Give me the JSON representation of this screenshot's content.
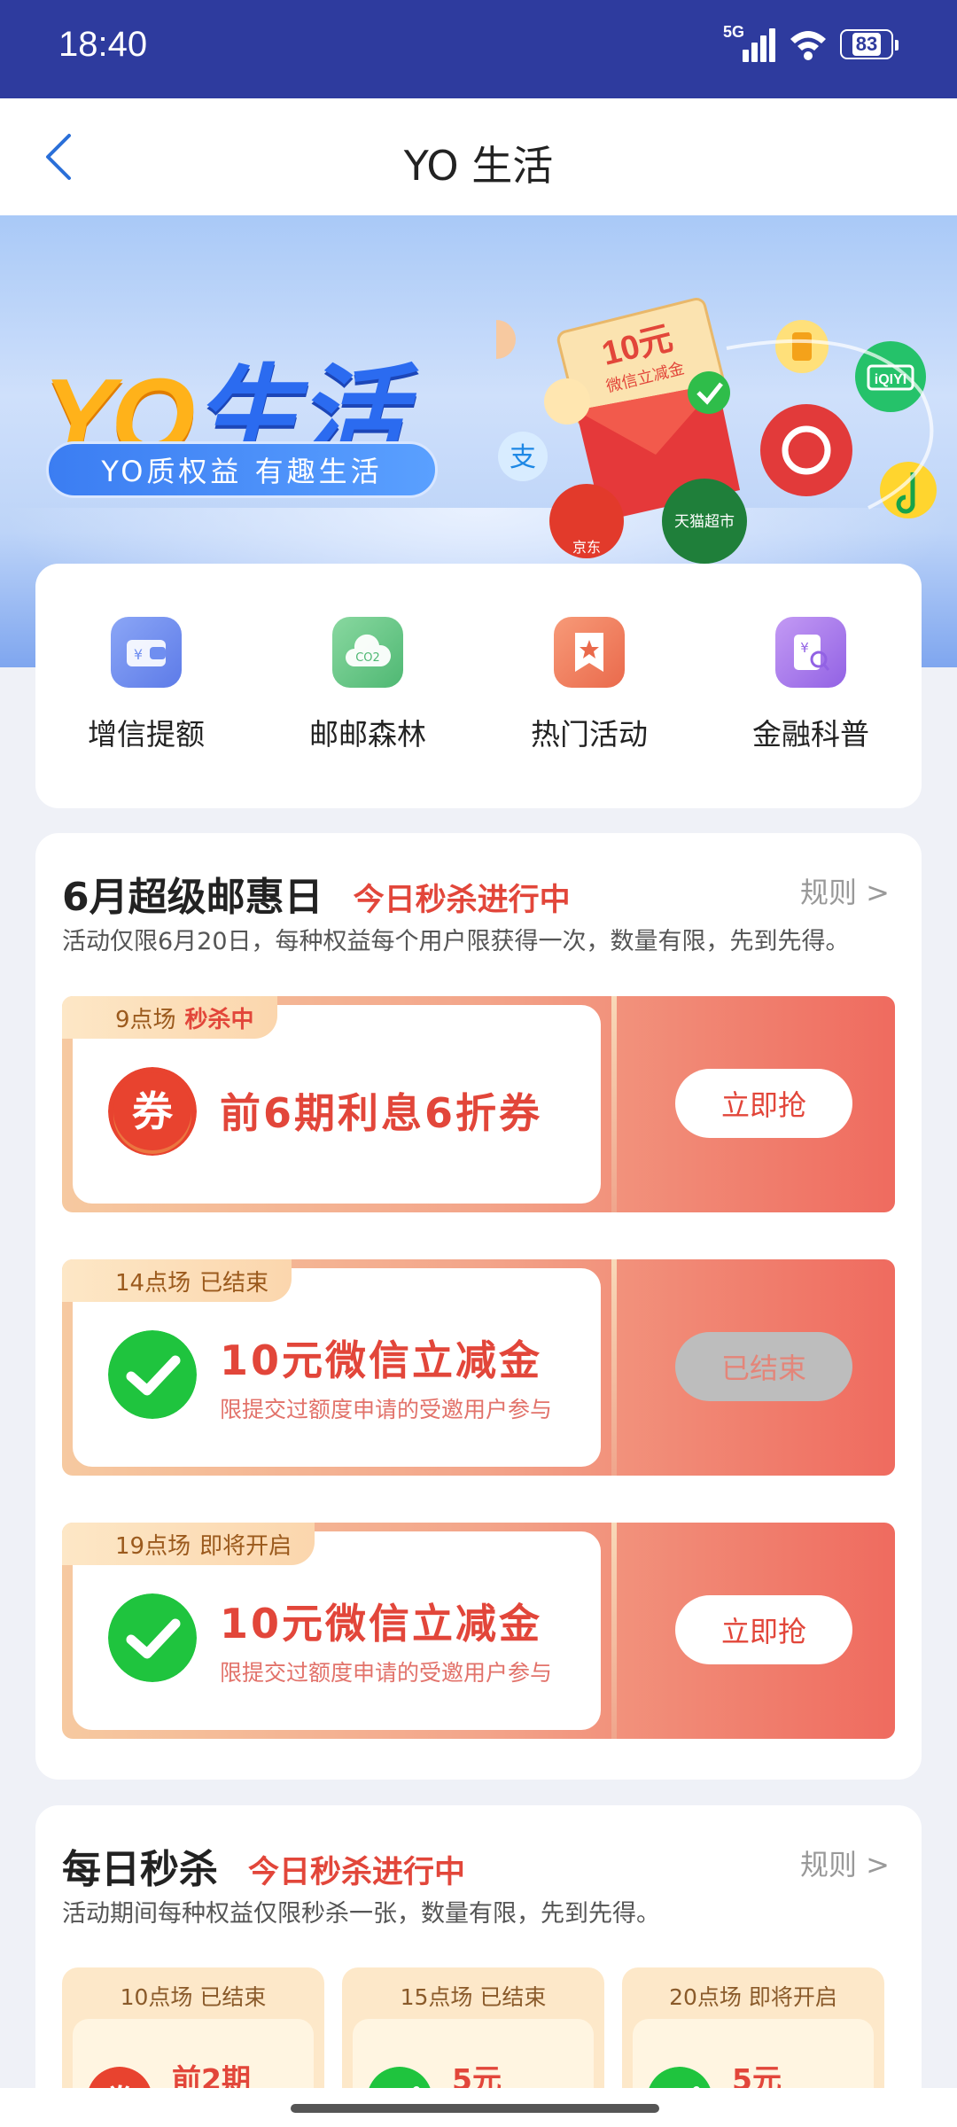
{
  "status": {
    "time": "18:40",
    "network": "5G",
    "battery": "83"
  },
  "nav": {
    "title": "YO 生活"
  },
  "banner": {
    "logo_yo": "YO",
    "logo_sh": "生活",
    "slogan": "YO质权益 有趣生活",
    "coupon_amount": "10元",
    "coupon_text": "微信立减金",
    "jd_label": "京东",
    "tmall_label": "天猫超市",
    "iqiyi_label": "iQIYI",
    "alipay_label": "支"
  },
  "quick_menu": [
    {
      "label": "增信提额",
      "icon": "wallet-icon",
      "color": "#6f8ef0"
    },
    {
      "label": "邮邮森林",
      "icon": "cloud-co2-icon",
      "color": "#5fc27e"
    },
    {
      "label": "热门活动",
      "icon": "bookmark-star-icon",
      "color": "#f07a56"
    },
    {
      "label": "金融科普",
      "icon": "document-search-icon",
      "color": "#a56ee9"
    }
  ],
  "super_day": {
    "title": "6月超级邮惠日",
    "subtitle": "今日秒杀进行中",
    "rule": "规则 >",
    "desc": "活动仅限6月20日，每种权益每个用户限获得一次，数量有限，先到先得。",
    "deals": [
      {
        "session": "9点场",
        "state": "秒杀中",
        "name": "前6期利息6折券",
        "note": "",
        "button": "立即抢",
        "icon": "coupon-icon",
        "ended": false
      },
      {
        "session": "14点场",
        "state": "已结束",
        "name": "10元微信立减金",
        "note": "限提交过额度申请的受邀用户参与",
        "button": "已结束",
        "icon": "wechat-icon",
        "ended": true
      },
      {
        "session": "19点场",
        "state": "即将开启",
        "name": "10元微信立减金",
        "note": "限提交过额度申请的受邀用户参与",
        "button": "立即抢",
        "icon": "wechat-icon",
        "ended": false
      }
    ]
  },
  "daily": {
    "title": "每日秒杀",
    "subtitle": "今日秒杀进行中",
    "rule": "规则 >",
    "desc": "活动期间每种权益仅限秒杀一张，数量有限，先到先得。",
    "items": [
      {
        "tag": "10点场 已结束",
        "name": "前2期",
        "icon": "coupon-icon"
      },
      {
        "tag": "15点场 已结束",
        "name": "5元",
        "icon": "wechat-icon"
      },
      {
        "tag": "20点场 即将开启",
        "name": "5元",
        "icon": "wechat-icon"
      }
    ]
  },
  "colors": {
    "status_bar": "#2e3b9e",
    "accent_red": "#e2463a",
    "brand_blue": "#2b6bf0"
  }
}
